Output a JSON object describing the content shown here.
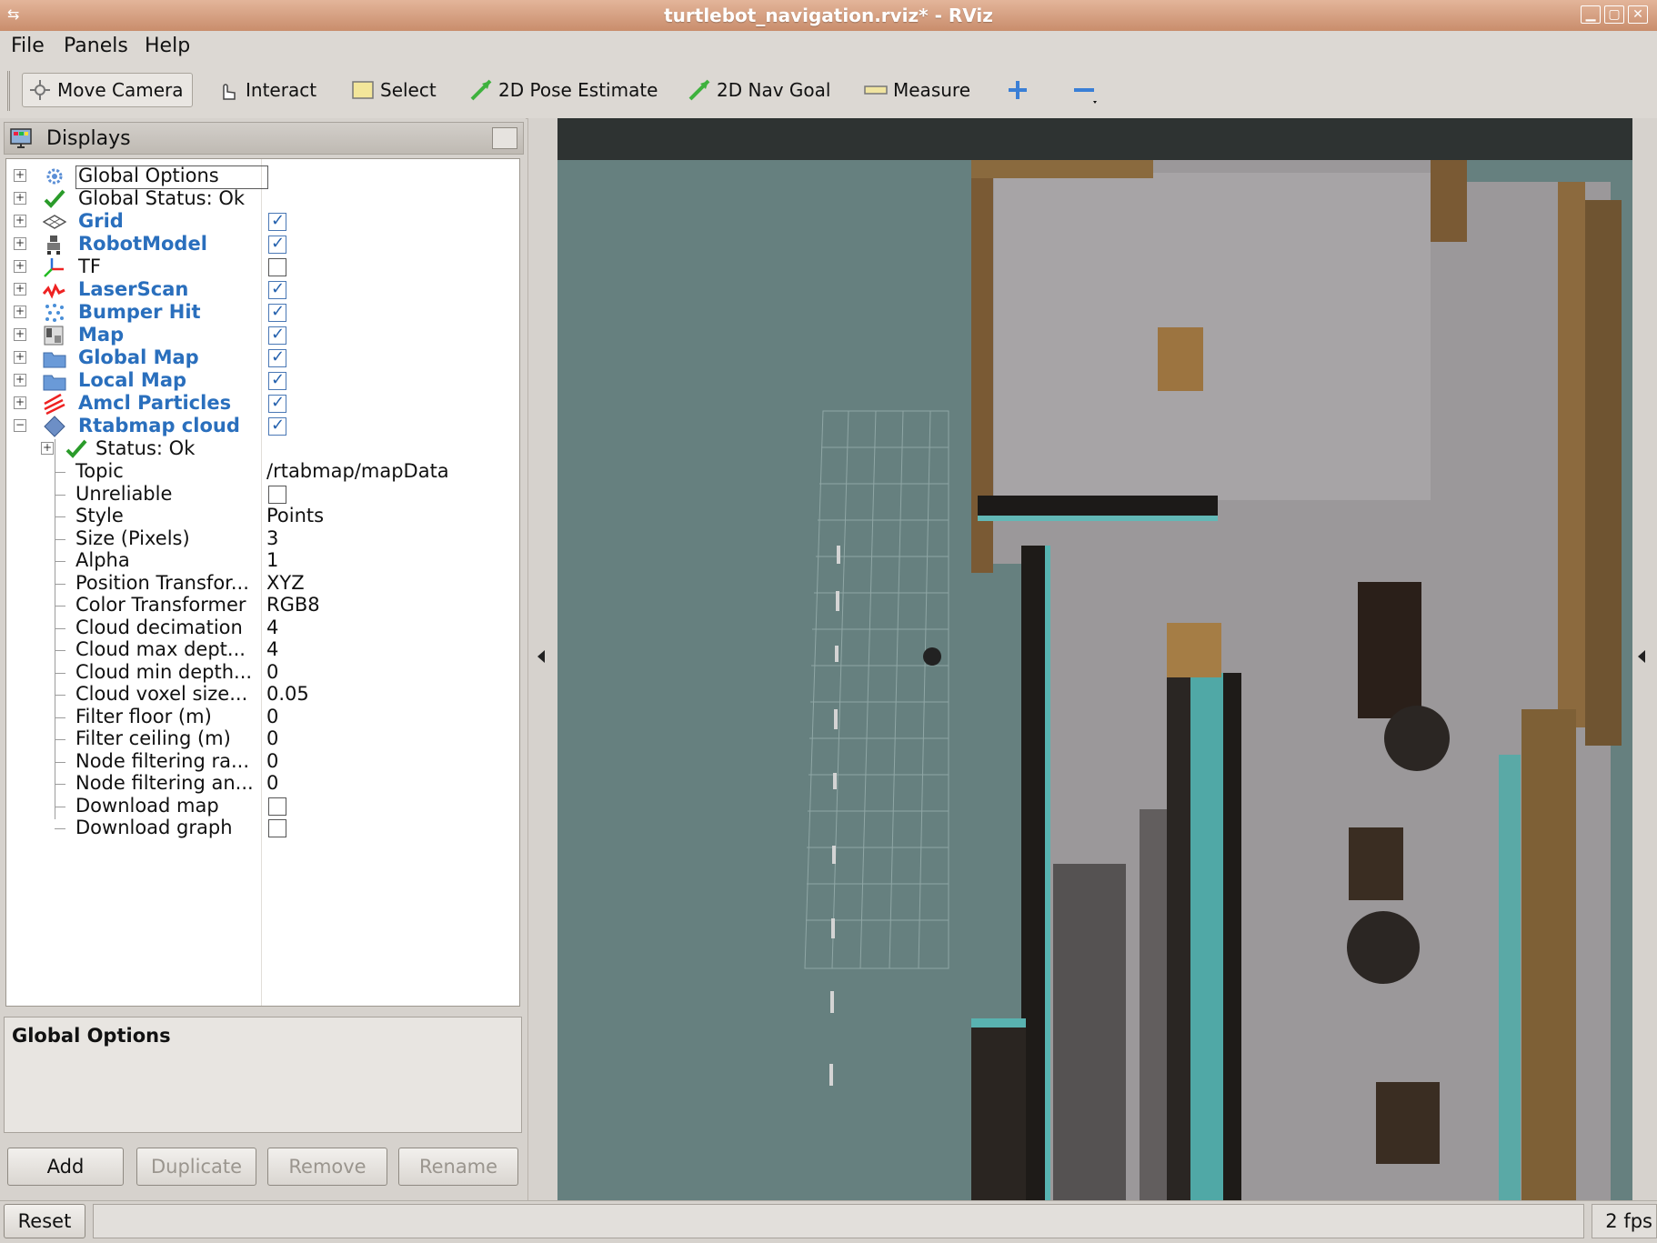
{
  "window": {
    "title": "turtlebot_navigation.rviz* - RViz"
  },
  "menu": [
    "File",
    "Panels",
    "Help"
  ],
  "toolbar": {
    "move_camera": "Move Camera",
    "interact": "Interact",
    "select": "Select",
    "pose_estimate": "2D Pose Estimate",
    "nav_goal": "2D Nav Goal",
    "measure": "Measure"
  },
  "displays": {
    "header": "Displays",
    "items": [
      {
        "label": "Global Options",
        "icon": "gear-icon"
      },
      {
        "label": "Global Status: Ok",
        "icon": "check-icon"
      },
      {
        "label": "Grid",
        "icon": "grid-icon",
        "checked": true
      },
      {
        "label": "RobotModel",
        "icon": "robot-icon",
        "checked": true
      },
      {
        "label": "TF",
        "icon": "axes-icon",
        "checked": false
      },
      {
        "label": "LaserScan",
        "icon": "laser-icon",
        "checked": true
      },
      {
        "label": "Bumper Hit",
        "icon": "points-icon",
        "checked": true
      },
      {
        "label": "Map",
        "icon": "map-icon",
        "checked": true
      },
      {
        "label": "Global Map",
        "icon": "folder-icon",
        "checked": true
      },
      {
        "label": "Local Map",
        "icon": "folder-icon",
        "checked": true
      },
      {
        "label": "Amcl Particles",
        "icon": "arrows-icon",
        "checked": true
      },
      {
        "label": "Rtabmap cloud",
        "icon": "diamond-icon",
        "checked": true
      }
    ],
    "sub": {
      "status": "Status: Ok",
      "props": [
        {
          "name": "Topic",
          "value": "/rtabmap/mapData"
        },
        {
          "name": "Unreliable",
          "checkbox": false
        },
        {
          "name": "Style",
          "value": "Points"
        },
        {
          "name": "Size (Pixels)",
          "value": "3"
        },
        {
          "name": "Alpha",
          "value": "1"
        },
        {
          "name": "Position Transfor...",
          "value": "XYZ"
        },
        {
          "name": "Color Transformer",
          "value": "RGB8"
        },
        {
          "name": "Cloud decimation",
          "value": "4"
        },
        {
          "name": "Cloud max dept...",
          "value": "4"
        },
        {
          "name": "Cloud min depth...",
          "value": "0"
        },
        {
          "name": "Cloud voxel size...",
          "value": "0.05"
        },
        {
          "name": "Filter floor (m)",
          "value": "0"
        },
        {
          "name": "Filter ceiling (m)",
          "value": "0"
        },
        {
          "name": "Node filtering ra...",
          "value": "0"
        },
        {
          "name": "Node filtering an...",
          "value": "0"
        },
        {
          "name": "Download map",
          "checkbox": false
        },
        {
          "name": "Download graph",
          "checkbox": false
        }
      ]
    }
  },
  "description": {
    "title": "Global Options"
  },
  "buttons": {
    "add": "Add",
    "duplicate": "Duplicate",
    "remove": "Remove",
    "rename": "Rename"
  },
  "status": {
    "reset": "Reset",
    "fps": "2 fps"
  }
}
